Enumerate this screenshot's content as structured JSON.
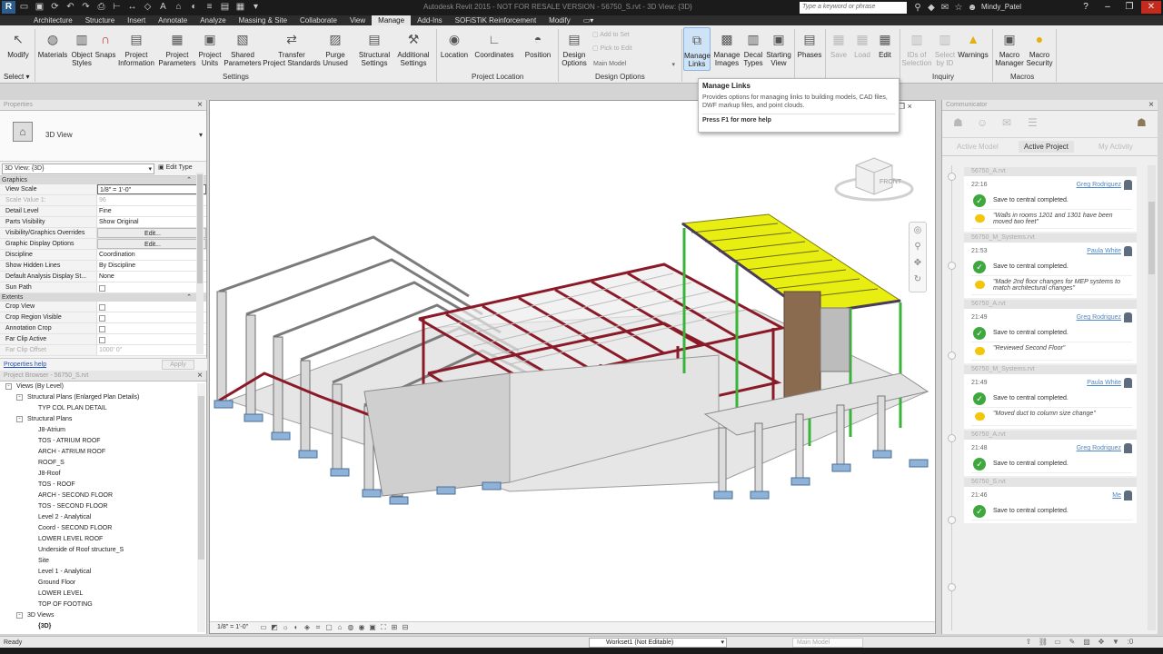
{
  "title_bar": {
    "doc_title": "Autodesk Revit 2015 - NOT FOR RESALE VERSION - 56750_S.rvt - 3D View: {3D}",
    "search_placeholder": "Type a keyword or phrase",
    "user": "Mindy_Patel"
  },
  "tabs": [
    {
      "label": "Architecture"
    },
    {
      "label": "Structure"
    },
    {
      "label": "Insert"
    },
    {
      "label": "Annotate"
    },
    {
      "label": "Analyze"
    },
    {
      "label": "Massing & Site"
    },
    {
      "label": "Collaborate"
    },
    {
      "label": "View"
    },
    {
      "label": "Manage"
    },
    {
      "label": "Add-Ins"
    },
    {
      "label": "SOFiSTiK Reinforcement"
    },
    {
      "label": "Modify"
    }
  ],
  "ribbon": {
    "modify": "Modify",
    "select": "Select ▾",
    "settings": {
      "materials": "Materials",
      "object_styles_1": "Object",
      "object_styles_2": "Styles",
      "snaps": "Snaps",
      "project_info_1": "Project",
      "project_info_2": "Information",
      "project_params_1": "Project",
      "project_params_2": "Parameters",
      "project_units_1": "Project",
      "project_units_2": "Units",
      "shared_params_1": "Shared",
      "shared_params_2": "Parameters",
      "transfer_1": "Transfer",
      "transfer_2": "Project Standards",
      "purge_1": "Purge",
      "purge_2": "Unused",
      "struct_settings_1": "Structural",
      "struct_settings_2": "Settings",
      "additional_1": "Additional",
      "additional_2": "Settings",
      "panel": "Settings"
    },
    "project_location": {
      "location": "Location",
      "coordinates": "Coordinates",
      "position": "Position",
      "panel": "Project Location"
    },
    "design_options": {
      "options_1": "Design",
      "options_2": "Options",
      "add_to_set": "Add to Set",
      "pick_to_edit": "Pick to Edit",
      "main_model": "Main Model",
      "panel": "Design Options"
    },
    "manage_project": {
      "manage_links_1": "Manage",
      "manage_links_2": "Links",
      "manage_images_1": "Manage",
      "manage_images_2": "Images",
      "decal_1": "Decal",
      "decal_2": "Types",
      "starting_1": "Starting",
      "starting_2": "View"
    },
    "phasing": {
      "phases": "Phases"
    },
    "selection": {
      "save": "Save",
      "load": "Load",
      "edit": "Edit"
    },
    "inquiry": {
      "ids_1": "IDs of",
      "ids_2": "Selection",
      "select_by_id_1": "Select",
      "select_by_id_2": "by ID",
      "warnings": "Warnings",
      "panel": "Inquiry"
    },
    "macros": {
      "manager_1": "Macro",
      "manager_2": "Manager",
      "security_1": "Macro",
      "security_2": "Security",
      "panel": "Macros"
    }
  },
  "tooltip": {
    "title": "Manage Links",
    "body": "Provides options for managing links to building models, CAD files, DWF markup files, and point clouds.",
    "help": "Press F1 for more help"
  },
  "properties": {
    "header": "Properties",
    "type_name": "3D View",
    "view_filter": "3D View: {3D}",
    "edit_type": "Edit Type",
    "groups": {
      "graphics": "Graphics",
      "extents": "Extents"
    },
    "rows": [
      {
        "name": "View Scale",
        "value": "1/8\" = 1'-0\""
      },
      {
        "name": "Scale Value    1:",
        "value": "96"
      },
      {
        "name": "Detail Level",
        "value": "Fine"
      },
      {
        "name": "Parts Visibility",
        "value": "Show Original"
      },
      {
        "name": "Visibility/Graphics Overrides",
        "value": "Edit..."
      },
      {
        "name": "Graphic Display Options",
        "value": "Edit..."
      },
      {
        "name": "Discipline",
        "value": "Coordination"
      },
      {
        "name": "Show Hidden Lines",
        "value": "By Discipline"
      },
      {
        "name": "Default Analysis Display St...",
        "value": "None"
      },
      {
        "name": "Sun Path",
        "value": ""
      }
    ],
    "extent_rows": [
      {
        "name": "Crop View",
        "value": ""
      },
      {
        "name": "Crop Region Visible",
        "value": ""
      },
      {
        "name": "Annotation Crop",
        "value": ""
      },
      {
        "name": "Far Clip Active",
        "value": ""
      },
      {
        "name": "Far Clip Offset",
        "value": "1000' 0\""
      }
    ],
    "help_link": "Properties help",
    "apply": "Apply"
  },
  "browser": {
    "header": "Project Browser - 56750_S.rvt",
    "items": [
      {
        "label": "Views (By Level)",
        "indent": 0,
        "expand": "-"
      },
      {
        "label": "Structural Plans (Enlarged Plan Details)",
        "indent": 1,
        "expand": "-"
      },
      {
        "label": "TYP COL PLAN DETAIL",
        "indent": 2,
        "expand": ""
      },
      {
        "label": "Structural Plans",
        "indent": 1,
        "expand": "-"
      },
      {
        "label": "J8-Atrium",
        "indent": 2,
        "expand": ""
      },
      {
        "label": "TOS - ATRIUM ROOF",
        "indent": 2,
        "expand": ""
      },
      {
        "label": "ARCH - ATRIUM ROOF",
        "indent": 2,
        "expand": ""
      },
      {
        "label": "ROOF_S",
        "indent": 2,
        "expand": ""
      },
      {
        "label": "J8-Roof",
        "indent": 2,
        "expand": ""
      },
      {
        "label": "TOS - ROOF",
        "indent": 2,
        "expand": ""
      },
      {
        "label": "ARCH - SECOND FLOOR",
        "indent": 2,
        "expand": ""
      },
      {
        "label": "TOS - SECOND FLOOR",
        "indent": 2,
        "expand": ""
      },
      {
        "label": "Level 2 - Analytical",
        "indent": 2,
        "expand": ""
      },
      {
        "label": "Coord - SECOND FLOOR",
        "indent": 2,
        "expand": ""
      },
      {
        "label": "LOWER LEVEL ROOF",
        "indent": 2,
        "expand": ""
      },
      {
        "label": "Underside of Roof structure_S",
        "indent": 2,
        "expand": ""
      },
      {
        "label": "Site",
        "indent": 2,
        "expand": ""
      },
      {
        "label": "Level 1 - Analytical",
        "indent": 2,
        "expand": ""
      },
      {
        "label": "Ground Floor",
        "indent": 2,
        "expand": ""
      },
      {
        "label": "LOWER LEVEL",
        "indent": 2,
        "expand": ""
      },
      {
        "label": "TOP OF FOOTING",
        "indent": 2,
        "expand": ""
      },
      {
        "label": "3D Views",
        "indent": 1,
        "expand": "-"
      },
      {
        "label": "{3D}",
        "indent": 2,
        "expand": ""
      }
    ]
  },
  "viewport": {
    "scale": "1/8\" = 1'-0\"",
    "cube_label": "FRONT"
  },
  "communicator": {
    "header": "Communicator",
    "tabs": {
      "active_model": "Active Model",
      "active_project": "Active Project",
      "my_activity": "My Activity"
    },
    "cards": [
      {
        "file": "56750_A.rvt",
        "time": "22:16",
        "user": "Greg Rodriguez",
        "ok": "Save to central completed.",
        "msg": "\"Walls in rooms 1201 and 1301 have been moved two feet\""
      },
      {
        "file": "56750_M_Systems.rvt",
        "time": "21:53",
        "user": "Paula White",
        "ok": "Save to central completed.",
        "msg": "\"Made 2nd floor changes for MEP systems to match architectural changes\""
      },
      {
        "file": "56750_A.rvt",
        "time": "21:49",
        "user": "Greg Rodriguez",
        "ok": "Save to central completed.",
        "msg": "\"Reviewed Second Floor\""
      },
      {
        "file": "56750_M_Systems.rvt",
        "time": "21:49",
        "user": "Paula White",
        "ok": "Save to central completed.",
        "msg": "\"Moved duct to column size change\""
      },
      {
        "file": "56750_A.rvt",
        "time": "21:48",
        "user": "Greg Rodriguez",
        "ok": "Save to central completed.",
        "msg": ""
      },
      {
        "file": "56750_S.rvt",
        "time": "21:46",
        "user": "Me",
        "ok": "Save to central completed.",
        "msg": ""
      }
    ]
  },
  "status": {
    "text": "Ready",
    "workset": "Workset1 (Not Editable)",
    "model": "Main Model",
    "zero": ":0"
  },
  "colors": {
    "accent": "#cfe3f6",
    "ok_green": "#3ea83e",
    "comment_yellow": "#f3c60c",
    "beam_red": "#8b1a28",
    "roof_yellow": "#e9ee12"
  }
}
